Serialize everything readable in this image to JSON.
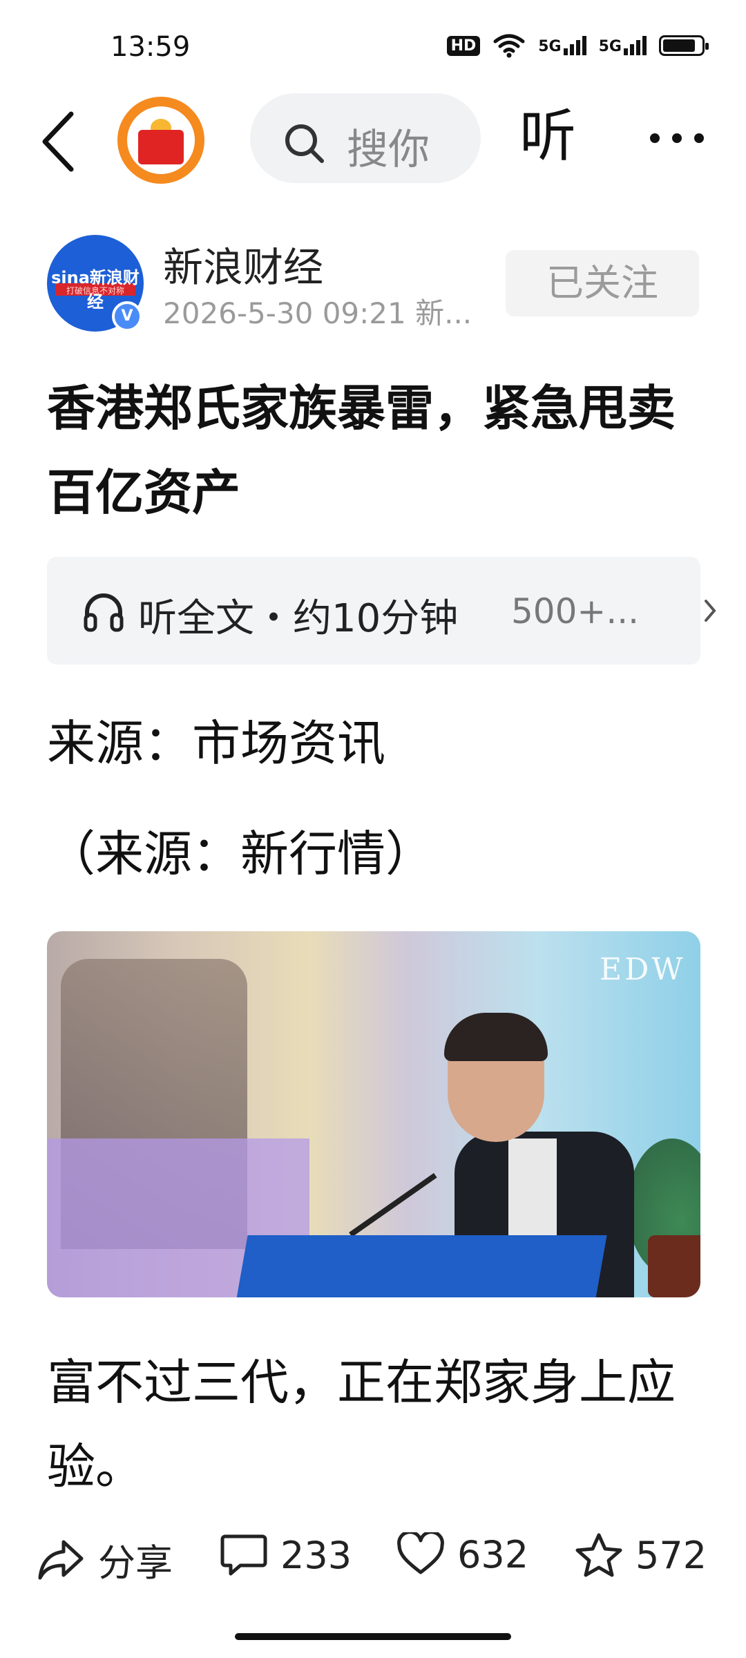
{
  "status_bar": {
    "time": "13:59",
    "hd_label": "HD",
    "signal1_label": "5G",
    "signal2_label": "5G",
    "battery_level": 0.85
  },
  "topbar": {
    "search_placeholder": "搜你",
    "listen_label": "听"
  },
  "author": {
    "name": "新浪财经",
    "avatar_text": "sina新浪财经",
    "avatar_slogan": "打破信息不对称",
    "verified_mark": "V",
    "meta": "2026-5-30  09:21  新...",
    "follow_label": "已关注"
  },
  "article": {
    "title": "香港郑氏家族暴雷，紧急甩卖百亿资产",
    "listen_full": "听全文・约10分钟",
    "listen_count": "500+...",
    "source_line": "来源：市场资讯",
    "source_note": "（来源：新行情）",
    "image_banner_text": "EDW",
    "body_text": "富不过三代，正在郑家身上应验。"
  },
  "actions": {
    "share_label": "分享",
    "comment_count": "233",
    "like_count": "632",
    "favorite_count": "572"
  },
  "icons": [
    "back-icon",
    "search-icon",
    "more-icon",
    "headphone-icon",
    "chevron-right-icon",
    "share-icon",
    "comment-icon",
    "like-icon",
    "star-icon",
    "wifi-icon",
    "battery-icon"
  ]
}
